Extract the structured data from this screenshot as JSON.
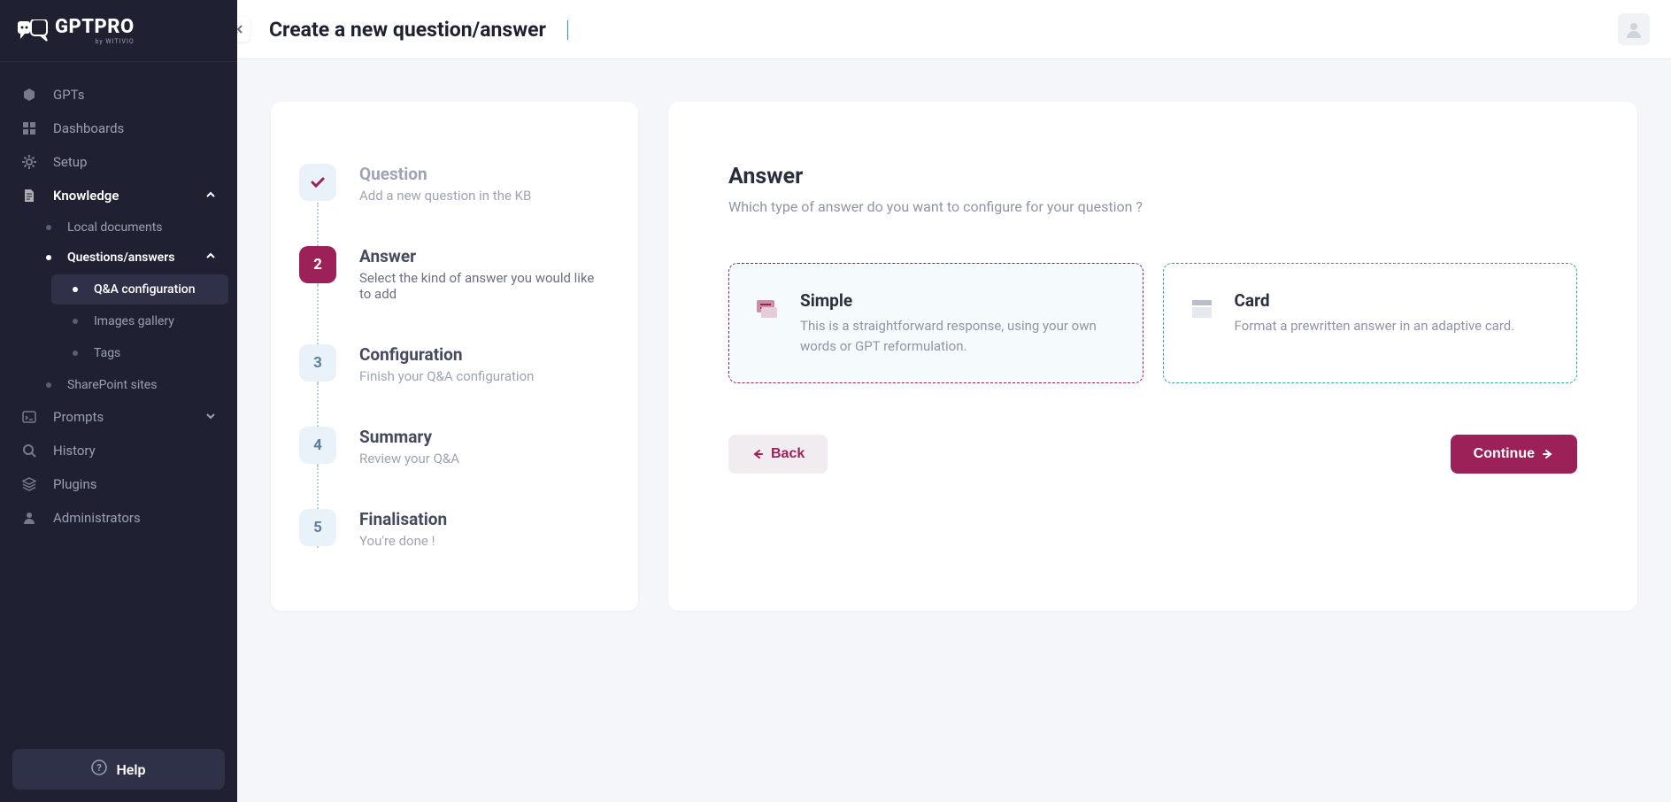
{
  "logo": {
    "text": "GPTPRO",
    "byline": "by WITIVIO"
  },
  "sidebar": {
    "items": [
      {
        "label": "GPTs"
      },
      {
        "label": "Dashboards"
      },
      {
        "label": "Setup"
      },
      {
        "label": "Knowledge"
      },
      {
        "label": "Prompts"
      },
      {
        "label": "History"
      },
      {
        "label": "Plugins"
      },
      {
        "label": "Administrators"
      }
    ],
    "knowledge_children": [
      {
        "label": "Local documents"
      },
      {
        "label": "Questions/answers"
      },
      {
        "label": "SharePoint sites"
      }
    ],
    "qa_children": [
      {
        "label": "Q&A configuration"
      },
      {
        "label": "Images gallery"
      },
      {
        "label": "Tags"
      }
    ],
    "help": "Help"
  },
  "header": {
    "title": "Create a new question/answer"
  },
  "steps": [
    {
      "title": "Question",
      "desc": "Add a new question in the KB"
    },
    {
      "title": "Answer",
      "desc": "Select the kind of answer you would like to add"
    },
    {
      "title": "Configuration",
      "desc": "Finish your Q&A configuration"
    },
    {
      "title": "Summary",
      "desc": "Review your Q&A"
    },
    {
      "title": "Finalisation",
      "desc": "You're done !"
    }
  ],
  "step_numbers": {
    "s2": "2",
    "s3": "3",
    "s4": "4",
    "s5": "5"
  },
  "answer": {
    "heading": "Answer",
    "subtitle": "Which type of answer do you want to configure for your question ?",
    "options": [
      {
        "title": "Simple",
        "desc": "This is a straightforward response, using your own words or GPT reformulation."
      },
      {
        "title": "Card",
        "desc": "Format a prewritten answer in an adaptive card."
      }
    ],
    "back": "Back",
    "continue": "Continue"
  }
}
